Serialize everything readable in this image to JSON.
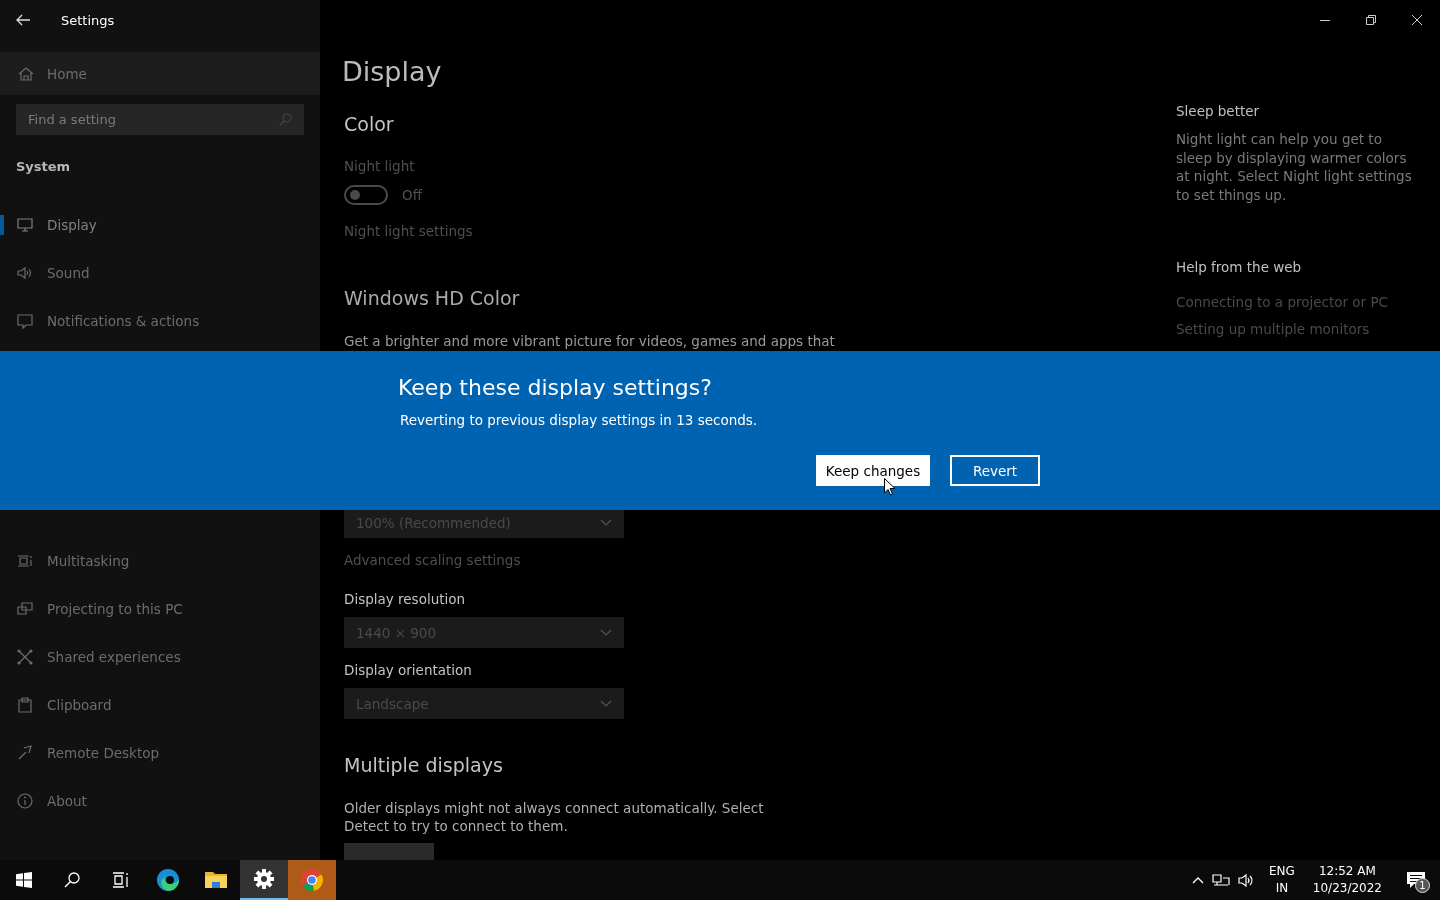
{
  "window": {
    "title": "Settings"
  },
  "sidebar": {
    "home": {
      "label": "Home",
      "kind": "home"
    },
    "search": {
      "placeholder": "Find a setting"
    },
    "section": "System",
    "items": [
      {
        "label": "Display",
        "kind": "display",
        "selected": true
      },
      {
        "label": "Sound",
        "kind": "sound",
        "selected": false
      },
      {
        "label": "Notifications & actions",
        "kind": "notifications",
        "selected": false
      }
    ],
    "lower_items": [
      {
        "label": "Multitasking",
        "kind": "multitasking",
        "selected": false
      },
      {
        "label": "Projecting to this PC",
        "kind": "projecting",
        "selected": false
      },
      {
        "label": "Shared experiences",
        "kind": "shared",
        "selected": false
      },
      {
        "label": "Clipboard",
        "kind": "clipboard",
        "selected": false
      },
      {
        "label": "Remote Desktop",
        "kind": "remote",
        "selected": false
      },
      {
        "label": "About",
        "kind": "about",
        "selected": false
      }
    ]
  },
  "main": {
    "title": "Display",
    "color_heading": "Color",
    "night_light": {
      "label": "Night light",
      "on": false,
      "state_text": "Off",
      "link": "Night light settings"
    },
    "hd_heading": "Windows HD Color",
    "hd_text": "Get a brighter and more vibrant picture for videos, games and apps that",
    "scale_dropdown": "100% (Recommended)",
    "scaling_link": "Advanced scaling settings",
    "resolution": {
      "label": "Display resolution",
      "value": "1440 × 900"
    },
    "orientation": {
      "label": "Display orientation",
      "value": "Landscape"
    },
    "multiple_heading": "Multiple displays",
    "multiple_text": "Older displays might not always connect automatically. Select Detect to try to connect to them."
  },
  "aside": {
    "sleep_heading": "Sleep better",
    "sleep_text": "Night light can help you get to sleep by displaying warmer colors at night. Select Night light settings to set things up.",
    "help_heading": "Help from the web",
    "links": [
      "Connecting to a projector or PC",
      "Setting up multiple monitors"
    ]
  },
  "dialog": {
    "title": "Keep these display settings?",
    "message": "Reverting to previous display settings in 13 seconds.",
    "buttons": [
      {
        "label": "Keep changes",
        "kind": "primary"
      },
      {
        "label": "Revert",
        "kind": "secondary"
      }
    ]
  },
  "taskbar": {
    "apps": [
      {
        "kind": "edge",
        "selected": false,
        "flashing": false
      },
      {
        "kind": "explorer",
        "selected": false,
        "flashing": false
      },
      {
        "kind": "settings",
        "selected": true,
        "flashing": false
      },
      {
        "kind": "chrome",
        "selected": false,
        "flashing": true
      }
    ],
    "language": "ENG",
    "region": "IN",
    "time": "12:52 AM",
    "date": "10/23/2022",
    "notification_count": "1"
  }
}
